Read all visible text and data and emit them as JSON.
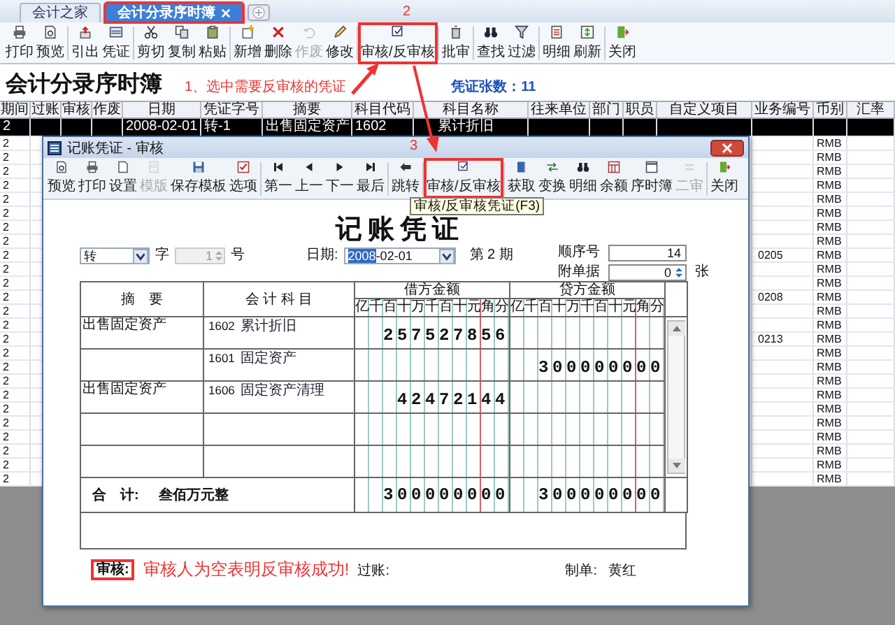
{
  "tabs": [
    {
      "label": "会计之家",
      "selected": false,
      "closable": false,
      "marked": false
    },
    {
      "label": "会计分录序时簿",
      "selected": true,
      "closable": true,
      "marked": true
    }
  ],
  "toolbar": {
    "step_label": "2",
    "buttons": [
      {
        "label": "打印",
        "disabled": false,
        "marked": false
      },
      {
        "label": "预览",
        "disabled": false,
        "marked": false
      },
      {
        "label": "引出",
        "disabled": false,
        "marked": false
      },
      {
        "label": "凭证",
        "disabled": false,
        "marked": false
      },
      {
        "label": "剪切",
        "disabled": false,
        "marked": false
      },
      {
        "label": "复制",
        "disabled": false,
        "marked": false
      },
      {
        "label": "粘贴",
        "disabled": false,
        "marked": false
      },
      {
        "label": "新增",
        "disabled": false,
        "marked": false
      },
      {
        "label": "删除",
        "disabled": false,
        "marked": false
      },
      {
        "label": "作废",
        "disabled": true,
        "marked": false
      },
      {
        "label": "修改",
        "disabled": false,
        "marked": false
      },
      {
        "label": "审核/反审核",
        "disabled": false,
        "marked": true
      },
      {
        "label": "批审",
        "disabled": false,
        "marked": false
      },
      {
        "label": "查找",
        "disabled": false,
        "marked": false
      },
      {
        "label": "过滤",
        "disabled": false,
        "marked": false
      },
      {
        "label": "明细",
        "disabled": false,
        "marked": false
      },
      {
        "label": "刷新",
        "disabled": false,
        "marked": false
      },
      {
        "label": "关闭",
        "disabled": false,
        "marked": false
      }
    ]
  },
  "page": {
    "title": "会计分录序时簿",
    "note": "1、选中需要反审核的凭证",
    "voucher_count": "凭证张数：11"
  },
  "table": {
    "columns": [
      "期间",
      "过账",
      "审核",
      "作废",
      "日期",
      "凭证字号",
      "摘要",
      "科目代码",
      "科目名称",
      "往来单位",
      "部门",
      "职员",
      "自定义项目",
      "业务编号",
      "币别",
      "汇率"
    ],
    "rows": [
      {
        "period": "2",
        "date": "2008-02-01",
        "voucher_no": "转-1",
        "summary": "出售固定资产",
        "account_code": "1602",
        "account_name": "累计折旧",
        "selected": true
      },
      {
        "period": "2",
        "currency": "RMB",
        "selected": false
      },
      {
        "period": "2",
        "currency": "RMB",
        "selected": false
      },
      {
        "period": "2",
        "currency": "RMB",
        "selected": false
      },
      {
        "period": "2",
        "currency": "RMB",
        "selected": false
      },
      {
        "period": "2",
        "currency": "RMB",
        "selected": false
      },
      {
        "period": "2",
        "currency": "RMB",
        "selected": false
      },
      {
        "period": "2",
        "currency": "RMB",
        "selected": false
      },
      {
        "period": "2",
        "currency": "RMB",
        "selected": false
      },
      {
        "period": "2",
        "business_no": "0205",
        "currency": "RMB",
        "selected": false
      },
      {
        "period": "2",
        "currency": "RMB",
        "selected": false
      },
      {
        "period": "2",
        "currency": "RMB",
        "selected": false
      },
      {
        "period": "2",
        "business_no": "0208",
        "currency": "RMB",
        "selected": false
      },
      {
        "period": "2",
        "currency": "RMB",
        "selected": false
      },
      {
        "period": "2",
        "currency": "RMB",
        "selected": false
      },
      {
        "period": "2",
        "business_no": "0213",
        "currency": "RMB",
        "selected": false
      },
      {
        "period": "2",
        "currency": "RMB",
        "selected": false
      },
      {
        "period": "2",
        "currency": "RMB",
        "selected": false
      },
      {
        "period": "2",
        "currency": "RMB",
        "selected": false
      },
      {
        "period": "2",
        "currency": "RMB",
        "selected": false
      },
      {
        "period": "2",
        "currency": "RMB",
        "selected": false
      },
      {
        "period": "2",
        "currency": "RMB",
        "selected": false
      },
      {
        "period": "2",
        "currency": "RMB",
        "selected": false
      },
      {
        "period": "2",
        "currency": "RMB",
        "selected": false
      },
      {
        "period": "2",
        "currency": "RMB",
        "selected": false
      },
      {
        "period": "2",
        "currency": "RMB",
        "selected": false
      }
    ]
  },
  "dialog": {
    "title": "记账凭证 - 审核",
    "step_label": "3",
    "tooltip": "审核/反审核凭证(F3)",
    "toolbar": {
      "buttons": [
        {
          "label": "预览",
          "disabled": false,
          "marked": false
        },
        {
          "label": "打印",
          "disabled": false,
          "marked": false
        },
        {
          "label": "设置",
          "disabled": false,
          "marked": false
        },
        {
          "label": "模版",
          "disabled": true,
          "marked": false
        },
        {
          "label": "保存模板",
          "disabled": false,
          "marked": false
        },
        {
          "label": "选项",
          "disabled": false,
          "marked": false
        },
        {
          "label": "第一",
          "disabled": false,
          "marked": false
        },
        {
          "label": "上一",
          "disabled": false,
          "marked": false
        },
        {
          "label": "下一",
          "disabled": false,
          "marked": false
        },
        {
          "label": "最后",
          "disabled": false,
          "marked": false
        },
        {
          "label": "跳转",
          "disabled": false,
          "marked": false
        },
        {
          "label": "审核/反审核",
          "disabled": false,
          "marked": true
        },
        {
          "label": "获取",
          "disabled": false,
          "marked": false
        },
        {
          "label": "变换",
          "disabled": false,
          "marked": false
        },
        {
          "label": "明细",
          "disabled": false,
          "marked": false
        },
        {
          "label": "余额",
          "disabled": false,
          "marked": false
        },
        {
          "label": "序时簿",
          "disabled": false,
          "marked": false
        },
        {
          "label": "二审",
          "disabled": true,
          "marked": false
        },
        {
          "label": "关闭",
          "disabled": false,
          "marked": false
        }
      ]
    },
    "voucher": {
      "title": "记账凭证",
      "voucher_word": "转",
      "word_label": "字",
      "number": "1",
      "number_label": "号",
      "date_label": "日期:",
      "date_selected": "2008",
      "date_rest": "-02-01",
      "period": "第 2 期",
      "sequence_label": "顺序号",
      "sequence": "14",
      "attachments_label": "附单据",
      "attachments": "0",
      "attachments_unit": "张",
      "columns": {
        "summary": "摘　要",
        "account": "会 计 科 目",
        "debit": "借方金额",
        "credit": "贷方金额",
        "debit_digits": "亿千百十万千百十元角分",
        "credit_digits": "亿千百十万千百十元角分"
      },
      "entries": [
        {
          "summary": "出售固定资产",
          "account_code": "1602",
          "account_name": "累计折旧",
          "debit": "257527856"
        },
        {
          "account_code": "1601",
          "account_name": "固定资产",
          "credit": "300000000"
        },
        {
          "summary": "出售固定资产",
          "account_code": "1606",
          "account_name": "固定资产清理",
          "debit": "42472144"
        }
      ],
      "total": {
        "label": "合　计:",
        "amount_words": "叁佰万元整",
        "debit": "300000000",
        "credit": "300000000"
      },
      "footer": {
        "auditor_label": "审核:",
        "note": "审核人为空表明反审核成功!",
        "posting_label": "过账:",
        "maker_label": "制单:",
        "maker": "黄红"
      }
    }
  }
}
